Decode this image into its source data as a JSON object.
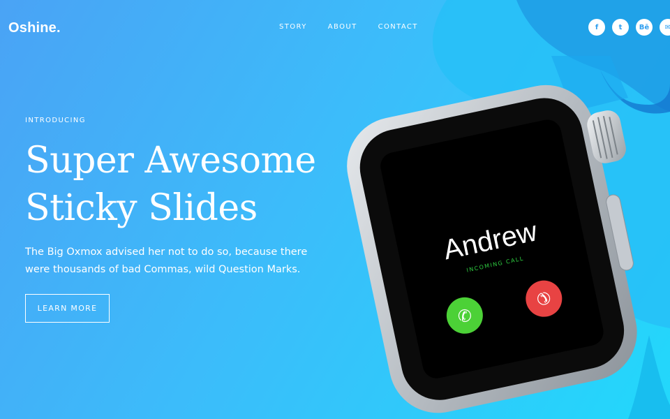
{
  "brand": {
    "logo": "Oshine."
  },
  "nav": {
    "items": [
      "STORY",
      "ABOUT",
      "CONTACT"
    ]
  },
  "social": [
    "f",
    "t",
    "Bē",
    "✉"
  ],
  "hero": {
    "eyebrow": "INTRODUCING",
    "headline_line1": "Super Awesome",
    "headline_line2": "Sticky Slides",
    "subtext": "The Big Oxmox advised her not to do so, because there were thousands of bad Commas, wild Question Marks.",
    "cta_label": "LEARN MORE"
  },
  "watch": {
    "caller_name": "Andrew",
    "call_status": "INCOMING CALL"
  },
  "colors": {
    "background_start": "#4aa3f5",
    "background_end": "#22d8fb",
    "accept": "#4cd137",
    "decline": "#e84343"
  }
}
